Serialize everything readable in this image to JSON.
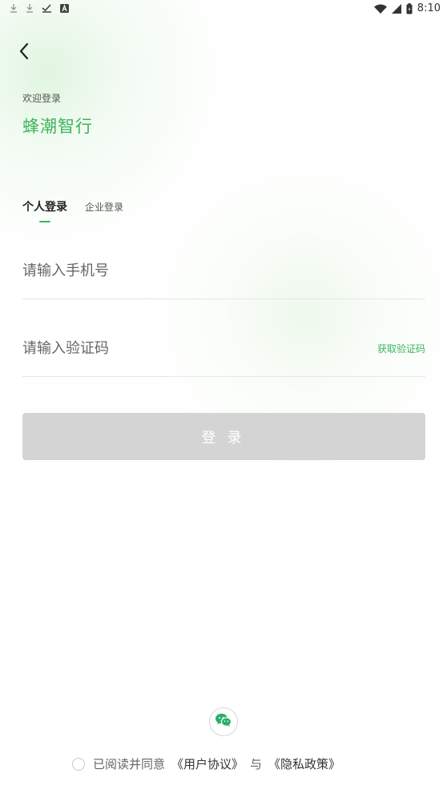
{
  "status_bar": {
    "time": "8:10",
    "icons_left": [
      "download-icon",
      "download-icon",
      "check-icon",
      "a-badge-icon"
    ],
    "icons_right": [
      "wifi-icon",
      "signal-icon",
      "battery-icon"
    ]
  },
  "header": {
    "back_icon": "chevron-left-icon",
    "welcome": "欢迎登录",
    "app_name": "蜂潮智行"
  },
  "tabs": [
    {
      "label": "个人登录",
      "active": true
    },
    {
      "label": "企业登录",
      "active": false
    }
  ],
  "form": {
    "phone_placeholder": "请输入手机号",
    "code_placeholder": "请输入验证码",
    "get_code_label": "获取验证码",
    "login_label": "登录"
  },
  "footer": {
    "wechat_icon": "wechat-icon",
    "agree_text": "已阅读并同意",
    "user_agreement": "《用户协议》",
    "and_text": "与",
    "privacy_policy": "《隐私政策》"
  },
  "colors": {
    "accent": "#3db45c",
    "button_disabled": "#d4d4d4",
    "wechat": "#2aae67"
  }
}
